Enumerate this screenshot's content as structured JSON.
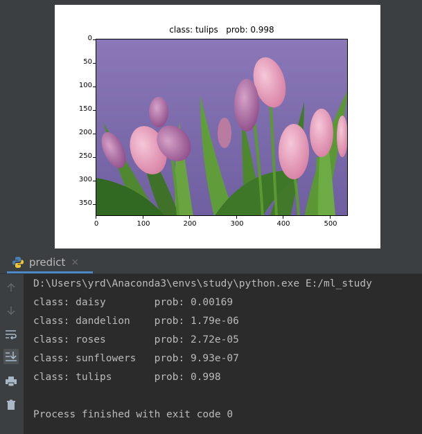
{
  "figure": {
    "title": "class: tulips   prob: 0.998",
    "y_ticks": [
      "0",
      "50",
      "100",
      "150",
      "200",
      "250",
      "300",
      "350"
    ],
    "x_ticks": [
      "0",
      "100",
      "200",
      "300",
      "400",
      "500"
    ],
    "image_subject": "pink tulips bouquet on purple background"
  },
  "run_panel": {
    "tab_label": "predict",
    "tab_close": "×",
    "command": "D:\\Users\\yrd\\Anaconda3\\envs\\study\\python.exe E:/ml_study",
    "results": [
      {
        "text": "class: daisy        prob: 0.00169"
      },
      {
        "text": "class: dandelion    prob: 1.79e-06"
      },
      {
        "text": "class: roses        prob: 2.72e-05"
      },
      {
        "text": "class: sunflowers   prob: 9.93e-07"
      },
      {
        "text": "class: tulips       prob: 0.998"
      }
    ],
    "exit_message": "Process finished with exit code 0",
    "toolbar_icons": [
      "up-arrow-icon",
      "down-arrow-icon",
      "soft-wrap-icon",
      "scroll-to-end-icon",
      "print-icon",
      "trash-icon"
    ]
  },
  "colors": {
    "ide_background": "#3c3f41",
    "console_background": "#2b2b2b",
    "console_text": "#bbbbbb",
    "tab_accent": "#4a88c7"
  }
}
